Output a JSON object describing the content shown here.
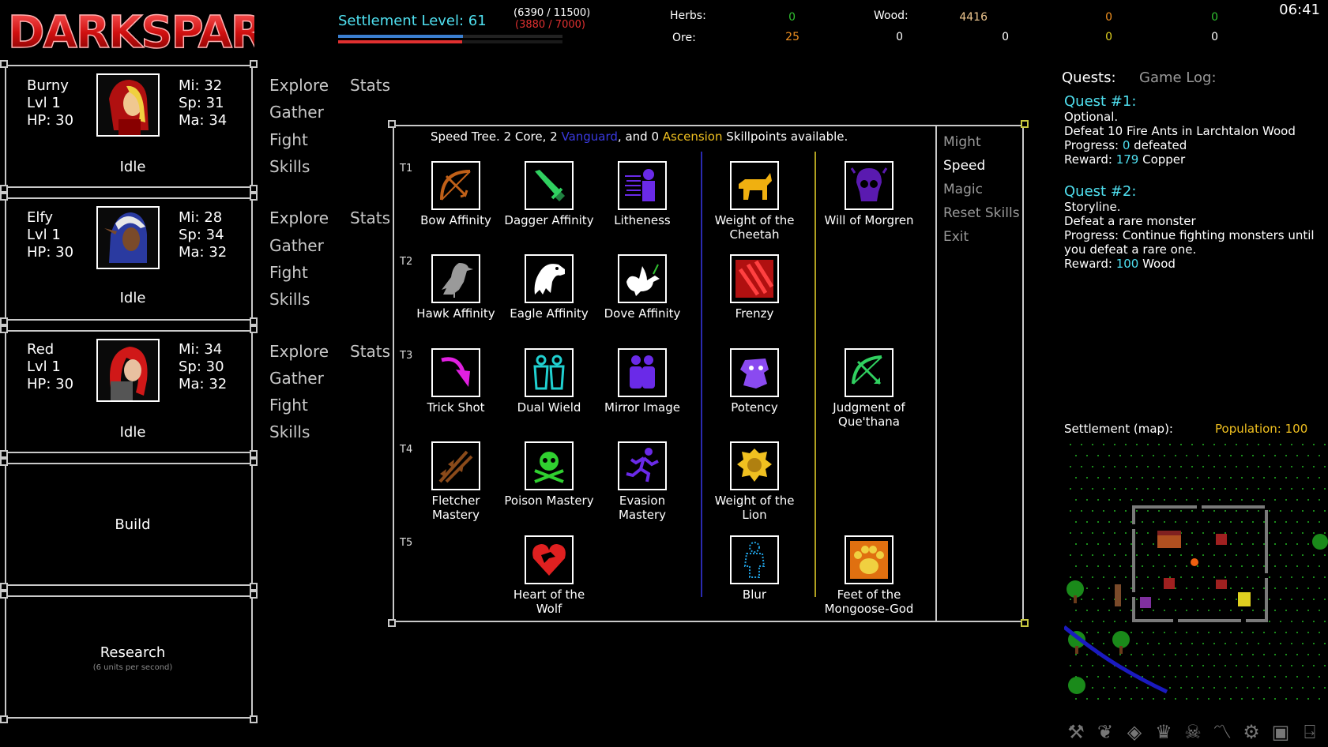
{
  "logo_text": "DARKSPAR",
  "settlement": {
    "label": "Settlement Level: 61",
    "xp_a": "(6390 / 11500)",
    "xp_b": "(3880 / 7000)",
    "xp_a_fraction": 0.556,
    "xp_b_fraction": 0.554
  },
  "resources": {
    "herbs_label": "Herbs:",
    "ore_label": "Ore:",
    "wood_label": "Wood:",
    "row1": [
      "0",
      "4416",
      "0",
      "0"
    ],
    "row2": [
      "25",
      "0",
      "0",
      "0",
      "0"
    ]
  },
  "clock": "06:41",
  "heroes": [
    {
      "name": "Burny",
      "lvl": "Lvl 1",
      "hp": "HP: 30",
      "mi": "Mi: 32",
      "sp": "Sp: 31",
      "ma": "Ma: 34",
      "status": "Idle"
    },
    {
      "name": "Elfy",
      "lvl": "Lvl 1",
      "hp": "HP: 30",
      "mi": "Mi: 28",
      "sp": "Sp: 34",
      "ma": "Ma: 32",
      "status": "Idle"
    },
    {
      "name": "Red",
      "lvl": "Lvl 1",
      "hp": "HP: 30",
      "mi": "Mi: 34",
      "sp": "Sp: 30",
      "ma": "Ma: 32",
      "status": "Idle"
    }
  ],
  "hero_menu": {
    "explore": "Explore",
    "gather": "Gather",
    "fight": "Fight",
    "skills": "Skills",
    "stats": "Stats"
  },
  "build": {
    "label": "Build"
  },
  "research": {
    "label": "Research",
    "sub": "(6 units per second)"
  },
  "skill_tree": {
    "header_a": "Speed Tree. 2 Core, 2 ",
    "header_vanguard": "Vanguard",
    "header_b": ", and 0 ",
    "header_ascension": "Ascension",
    "header_c": " Skillpoints available.",
    "tiers": [
      "T1",
      "T2",
      "T3",
      "T4",
      "T5"
    ],
    "skills": {
      "bow": "Bow Affinity",
      "dagger": "Dagger Affinity",
      "lith": "Litheness",
      "cheetah": "Weight of the Cheetah",
      "morgren": "Will of Morgren",
      "hawk": "Hawk Affinity",
      "eagle": "Eagle Affinity",
      "dove": "Dove Affinity",
      "frenzy": "Frenzy",
      "trick": "Trick Shot",
      "dual": "Dual Wield",
      "mirror": "Mirror Image",
      "potency": "Potency",
      "judgment": "Judgment of Que'thana",
      "fletcher": "Fletcher Mastery",
      "poison": "Poison Mastery",
      "evasion": "Evasion Mastery",
      "lion": "Weight of the Lion",
      "wolf": "Heart of the Wolf",
      "blur": "Blur",
      "mongoose": "Feet of the Mongoose-God"
    },
    "side_menu": [
      "Might",
      "Speed",
      "Magic",
      "Reset Skills",
      "Exit"
    ]
  },
  "quests": {
    "tab_quests": "Quests:",
    "tab_log": "Game Log:",
    "q1": {
      "title": "Quest #1:",
      "type": "Optional.",
      "desc": "Defeat 10 Fire Ants in Larchtalon Wood",
      "progress_a": "Progress: ",
      "progress_n": "0",
      "progress_b": " defeated",
      "reward_a": "Reward: ",
      "reward_n": "179",
      "reward_b": " Copper"
    },
    "q2": {
      "title": "Quest #2:",
      "type": "Storyline.",
      "desc": "Defeat a rare monster",
      "progress": "Progress: Continue fighting monsters until you defeat a rare one.",
      "reward_a": "Reward: ",
      "reward_n": "100",
      "reward_b": " Wood"
    }
  },
  "map": {
    "label": "Settlement (map):",
    "population": "Population: 100"
  },
  "colors": {
    "cyan": "#4fe0f0",
    "vanguard": "#3a3ae0",
    "ascension": "#f0c020",
    "red": "#e03030",
    "bar_blue": "#3b7fd0",
    "herb_green": "#30c030",
    "orange": "#f09020",
    "yellow": "#e0d020"
  }
}
